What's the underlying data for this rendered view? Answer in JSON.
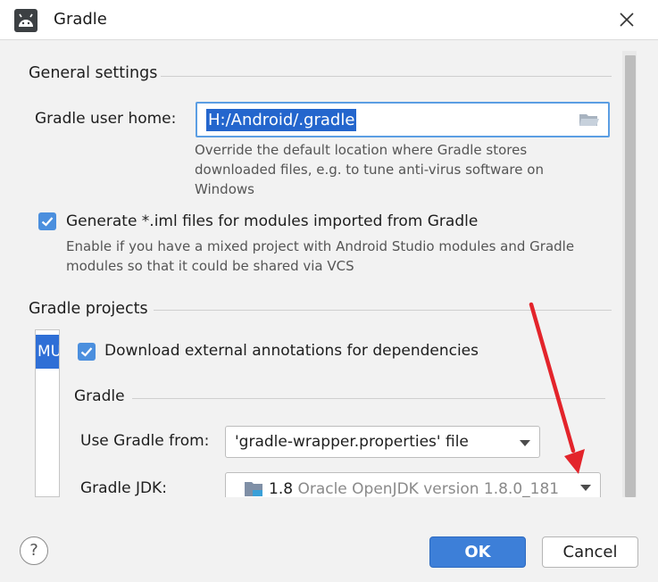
{
  "window": {
    "title": "Gradle"
  },
  "general": {
    "section_title": "General settings",
    "user_home_label": "Gradle user home:",
    "user_home_value": "H:/Android/.gradle",
    "user_home_hint": [
      "Override the default location where Gradle stores",
      "downloaded files, e.g. to tune anti-virus software on",
      "Windows"
    ],
    "iml_checkbox_label": "Generate *.iml files for modules imported from Gradle",
    "iml_checked": true,
    "iml_hint": [
      "Enable if you have a mixed project with Android Studio modules and Gradle",
      "modules so that it could be shared via VCS"
    ]
  },
  "projects": {
    "section_title": "Gradle projects",
    "list_items": [
      "MU"
    ],
    "annotations_checkbox_label": "Download external annotations for dependencies",
    "annotations_checked": true,
    "gradle_subsection_title": "Gradle",
    "use_gradle_from_label": "Use Gradle from:",
    "use_gradle_from_value": "'gradle-wrapper.properties' file",
    "jdk_label": "Gradle JDK:",
    "jdk_version": "1.8",
    "jdk_detail": "Oracle OpenJDK version 1.8.0_181"
  },
  "buttons": {
    "help": "?",
    "ok": "OK",
    "cancel": "Cancel"
  },
  "icons": {
    "app": "android-icon",
    "close": "close-icon",
    "folder": "folder-icon",
    "jdk": "jdk-folder-icon",
    "checkbox": "checkmark-icon"
  },
  "colors": {
    "accent": "#3d7fd8",
    "selection": "#2466cd",
    "annotation_arrow": "#e3242b"
  }
}
